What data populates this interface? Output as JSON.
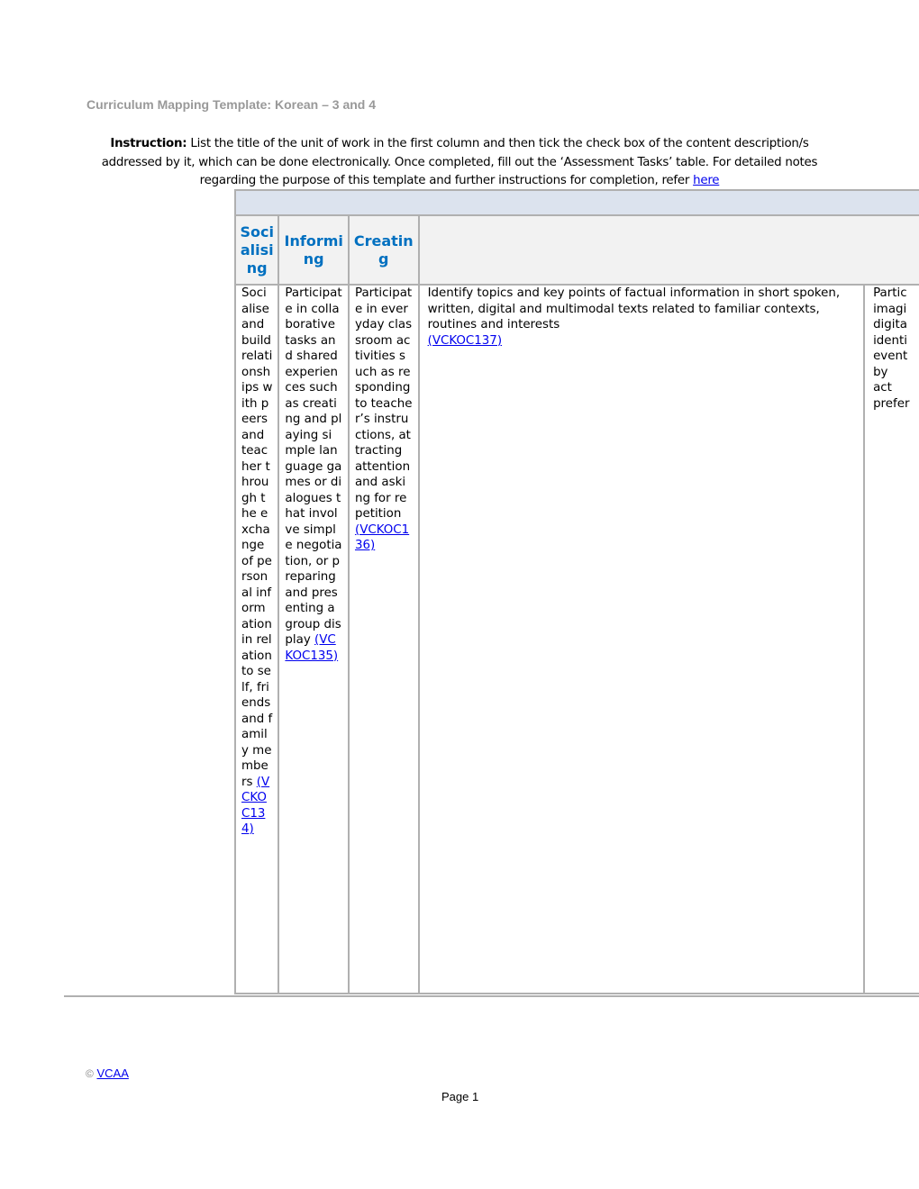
{
  "document": {
    "title": "Curriculum Mapping Template: Korean – 3 and 4",
    "instruction": {
      "label": "Instruction:",
      "text": " List the title of the unit of work in the first column and then tick the check box of the content description/s addressed by it, which can be done electronically. Once completed, fill out the ‘Assessment Tasks’ table. For detailed notes regarding the purpose of this template and further instructions for completion, refer ",
      "link_text": "here"
    }
  },
  "table": {
    "headers": [
      "Socialising",
      "Informing",
      "Creating",
      ""
    ],
    "cells": [
      {
        "text": "Socialise and build relationships with peers and teacher through the exchange of personal information in relation to self, friends and family members ",
        "code": "(VCKOC134)"
      },
      {
        "text": "Participate in collaborative tasks and shared experiences such as creating and playing simple language games or dialogues that involve simple negotiation, or preparing and presenting a group display ",
        "code": "(VCKOC135)"
      },
      {
        "text": "Participate in everyday classroom activities such as responding to teacher’s instructions, attracting attention and asking for repetition ",
        "code": "(VCKOC136)"
      },
      {
        "text": "Identify topics and key points of factual information in short spoken, written, digital and multimodal texts related to familiar contexts, routines and interests",
        "code": "(VCKOC137)"
      },
      {
        "text": "Partic imagi digita identi event by act prefer",
        "code": ""
      }
    ]
  },
  "footer": {
    "copyright_symbol": "©",
    "org_link": "VCAA",
    "page_label": "Page 1"
  },
  "colors": {
    "title_gray": "#999999",
    "header_blue": "#0070c0",
    "band_blue": "#dce3ee",
    "link_blue": "#0000ee",
    "border_gray": "#b0b0b0"
  }
}
